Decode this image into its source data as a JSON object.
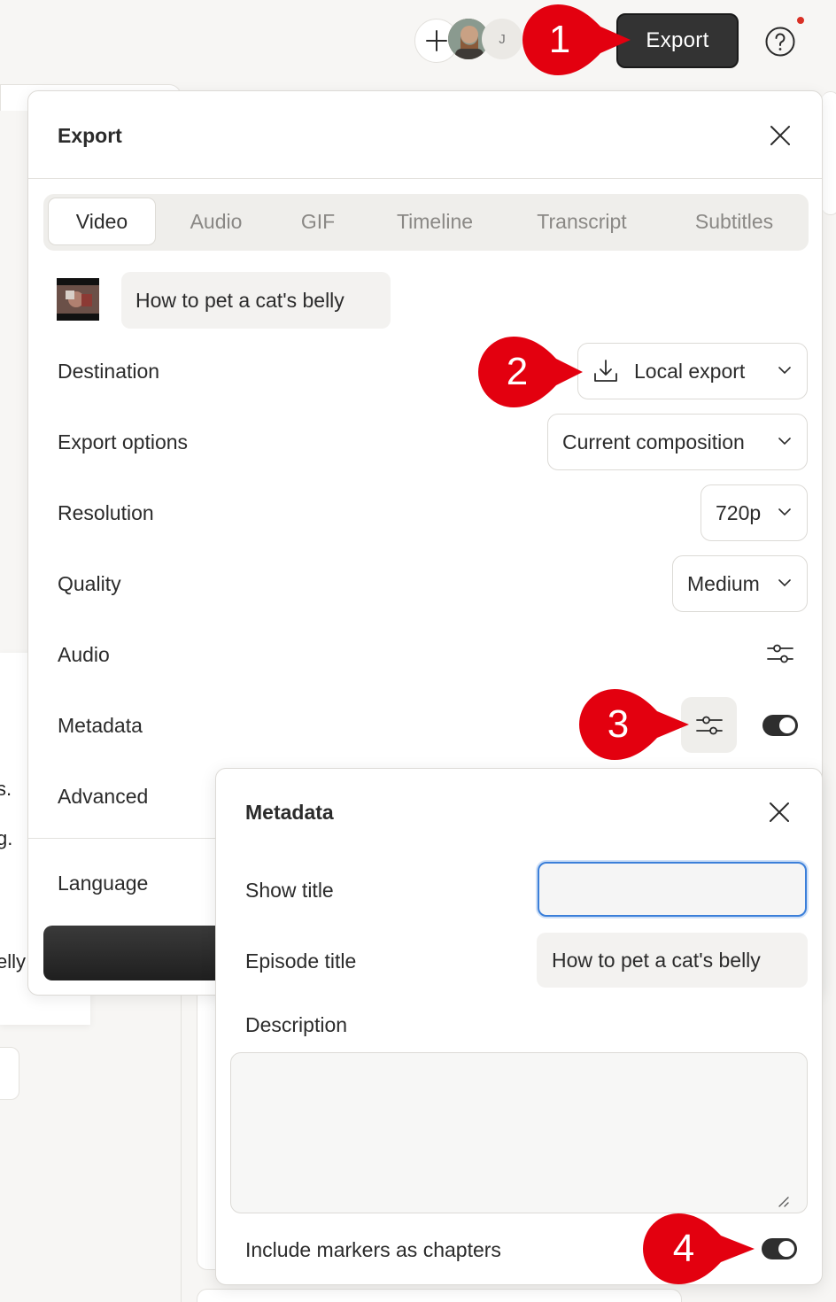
{
  "topbar": {
    "avatar_initial": "J",
    "export_label": "Export"
  },
  "background": {
    "frag1": "s.",
    "frag2": "g.",
    "frag3": "elly"
  },
  "export_panel": {
    "title": "Export",
    "tabs": [
      {
        "label": "Video",
        "active": true
      },
      {
        "label": "Audio",
        "active": false
      },
      {
        "label": "GIF",
        "active": false
      },
      {
        "label": "Timeline",
        "active": false
      },
      {
        "label": "Transcript",
        "active": false
      },
      {
        "label": "Subtitles",
        "active": false
      }
    ],
    "composition_name": "How to pet a cat's belly",
    "rows": {
      "destination": {
        "label": "Destination",
        "value": "Local export"
      },
      "export_options": {
        "label": "Export options",
        "value": "Current composition"
      },
      "resolution": {
        "label": "Resolution",
        "value": "720p"
      },
      "quality": {
        "label": "Quality",
        "value": "Medium"
      },
      "audio": {
        "label": "Audio"
      },
      "metadata": {
        "label": "Metadata",
        "enabled": true
      },
      "advanced": {
        "label": "Advanced"
      },
      "language": {
        "label": "Language"
      }
    }
  },
  "metadata_popover": {
    "title": "Metadata",
    "show_title": {
      "label": "Show title",
      "value": ""
    },
    "episode_title": {
      "label": "Episode title",
      "value": "How to pet a cat's belly"
    },
    "description": {
      "label": "Description",
      "value": ""
    },
    "include_markers": {
      "label": "Include markers as chapters",
      "enabled": true
    }
  },
  "callouts": [
    "1",
    "2",
    "3",
    "4"
  ],
  "colors": {
    "callout_red": "#e3000f",
    "accent_blue": "#3b7fd9",
    "dark_button": "#333333"
  }
}
